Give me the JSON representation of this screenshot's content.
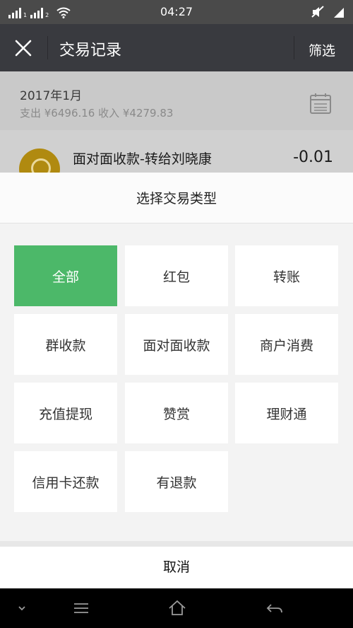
{
  "status_bar": {
    "time": "04:27",
    "signal_labels": [
      "1",
      "2"
    ]
  },
  "header": {
    "title": "交易记录",
    "filter_label": "筛选"
  },
  "summary": {
    "month": "2017年1月",
    "totals": "支出 ¥6496.16 收入 ¥4279.83"
  },
  "record": {
    "title": "面对面收款-转给刘晓康",
    "amount": "-0.01"
  },
  "sheet": {
    "title": "选择交易类型",
    "options": [
      {
        "label": "全部",
        "selected": true
      },
      {
        "label": "红包",
        "selected": false
      },
      {
        "label": "转账",
        "selected": false
      },
      {
        "label": "群收款",
        "selected": false
      },
      {
        "label": "面对面收款",
        "selected": false
      },
      {
        "label": "商户消费",
        "selected": false
      },
      {
        "label": "充值提现",
        "selected": false
      },
      {
        "label": "赞赏",
        "selected": false
      },
      {
        "label": "理财通",
        "selected": false
      },
      {
        "label": "信用卡还款",
        "selected": false
      },
      {
        "label": "有退款",
        "selected": false
      }
    ],
    "cancel_label": "取消"
  },
  "colors": {
    "accent": "#4cb869",
    "header_bg": "#393a3f",
    "status_bg": "#4a4a4a"
  },
  "icons": [
    "close-icon",
    "calendar-icon",
    "wifi-icon",
    "mute-icon",
    "battery-icon",
    "chevron-down-icon",
    "menu-icon",
    "home-icon",
    "back-icon"
  ]
}
